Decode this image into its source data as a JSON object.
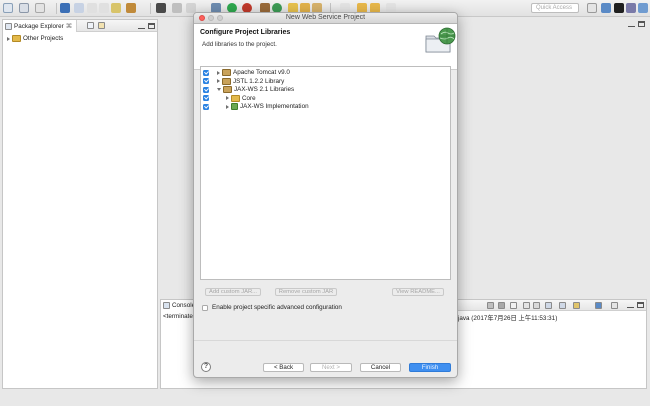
{
  "toolbar": {
    "quick_access_placeholder": "Quick Access"
  },
  "package_explorer": {
    "tab_label": "Package Explorer",
    "tab_close": "⌘",
    "items": [
      {
        "label": "Other Projects"
      }
    ]
  },
  "console": {
    "tab_label": "Console",
    "line_prefix": "<terminate",
    "line_suffix": "java (2017年7月26日 上午11:53:31)"
  },
  "dialog": {
    "title": "New Web Service Project",
    "header_title": "Configure Project Libraries",
    "header_desc": "Add libraries to the project.",
    "libraries": [
      {
        "label": "Apache Tomcat v9.0",
        "checked": true,
        "expanded": false
      },
      {
        "label": "JSTL 1.2.2 Library",
        "checked": true,
        "expanded": false
      },
      {
        "label": "JAX-WS 2.1 Libraries",
        "checked": true,
        "expanded": true
      },
      {
        "label": "Core",
        "checked": true,
        "expanded": false
      },
      {
        "label": "JAX-WS Implementation",
        "checked": true,
        "expanded": false
      }
    ],
    "add_custom_jar": "Add custom JAR...",
    "remove_custom_jar": "Remove custom JAR",
    "view_readme": "View README...",
    "advanced_config_label": "Enable project specific advanced configuration",
    "buttons": {
      "back": "< Back",
      "next": "Next >",
      "cancel": "Cancel",
      "finish": "Finish"
    },
    "help": "?"
  },
  "colors": {
    "accent": "#2b82e2",
    "finish_button": "#3f8ff0"
  }
}
